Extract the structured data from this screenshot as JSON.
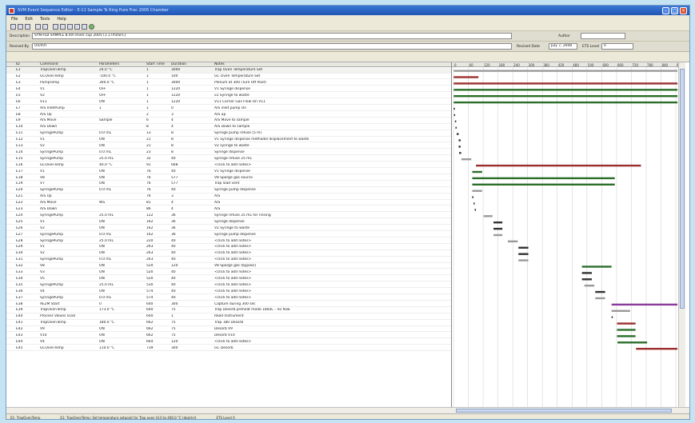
{
  "window": {
    "title": "SVM Event Sequence Editor - E-11 Sample Ts Ring Pure Frac 2005 Chamber"
  },
  "menu": [
    "File",
    "Edit",
    "Tools",
    "Help"
  ],
  "fields": {
    "description_label": "Description",
    "description_value": "SYN-FLB SAMPLE 8.4m River cup 2005 (1.17ml/SFC)",
    "revised_by_label": "Revised By",
    "revised_by_value": "UV/lnfT",
    "author_label": "Author",
    "author_value": "",
    "revised_date_label": "Revised Date",
    "revised_date_value": "July 7, 2008",
    "ets_level_label": "ETS Level",
    "ets_level_value": "0"
  },
  "columns": [
    "ID",
    "Command",
    "Parameters",
    "Start Time",
    "Duration",
    "Notes"
  ],
  "gantt_ticks": [
    "0",
    "60",
    "120",
    "180",
    "240",
    "300",
    "360",
    "420",
    "480",
    "540",
    "600",
    "660",
    "720",
    "780",
    "840",
    "900"
  ],
  "colors": {
    "green": "#2a6e2a",
    "red": "#9b2f2f",
    "purple": "#8a3a9a",
    "gray": "#9a9a9a",
    "black": "#333333"
  },
  "rows": [
    {
      "id": "E1",
      "cmd": "TrapOvenTemp",
      "par": "24.0 °C",
      "start": "1",
      "dur": "3000",
      "note": "Trap Oven Temperature Set",
      "bar": [
        1,
        3000
      ],
      "color": "gray"
    },
    {
      "id": "E2",
      "cmd": "GCOvenTemp",
      "par": "-100.0 °C",
      "start": "1",
      "dur": "100",
      "note": "GC Oven Temperature Set",
      "bar": [
        1,
        100
      ],
      "color": "red"
    },
    {
      "id": "E3",
      "cmd": "PumpTemp",
      "par": "300.0 °C",
      "start": "1",
      "dur": "3000",
      "note": "Plenum at 300 (Turn Off Poof)",
      "bar": [
        1,
        3000
      ],
      "color": "red"
    },
    {
      "id": "E4",
      "cmd": "V1",
      "par": "OFF",
      "start": "1",
      "dur": "1220",
      "note": "V1 Syringe dispense",
      "bar": [
        1,
        1220
      ],
      "color": "green"
    },
    {
      "id": "E5",
      "cmd": "V2",
      "par": "OFF",
      "start": "1",
      "dur": "1220",
      "note": "v2 Syringe to waste",
      "bar": [
        1,
        1220
      ],
      "color": "green"
    },
    {
      "id": "E6",
      "cmd": "V11",
      "par": "ON",
      "start": "1",
      "dur": "1220",
      "note": "V11 Carrier Gas Flow On V11",
      "bar": [
        1,
        1220
      ],
      "color": "green"
    },
    {
      "id": "E7",
      "cmd": "A/S InletPump",
      "par": "1",
      "start": "1",
      "dur": "0",
      "note": "A/S inlet pump On",
      "bar": [
        1,
        4
      ],
      "color": "black"
    },
    {
      "id": "E8",
      "cmd": "A/S Up",
      "par": "",
      "start": "2",
      "dur": "3",
      "note": "A/S up",
      "bar": [
        2,
        3
      ],
      "color": "black"
    },
    {
      "id": "E9",
      "cmd": "A/S Move",
      "par": "Sample",
      "start": "6",
      "dur": "4",
      "note": "A/S Move to sample",
      "bar": [
        6,
        4
      ],
      "color": "black"
    },
    {
      "id": "E10",
      "cmd": "A/S Down",
      "par": "",
      "start": "8",
      "dur": "4",
      "note": "A/S Down to sample",
      "bar": [
        8,
        4
      ],
      "color": "black"
    },
    {
      "id": "E11",
      "cmd": "SyringePump",
      "par": "0.0 mL",
      "start": "13",
      "dur": "8",
      "note": "Syringe pump refuse (5 m)",
      "bar": [
        13,
        8
      ],
      "color": "black"
    },
    {
      "id": "E12",
      "cmd": "V1",
      "par": "ON",
      "start": "21",
      "dur": "8",
      "note": "V1 Syringe dispense methodol displacement to waste",
      "bar": [
        21,
        8
      ],
      "color": "black"
    },
    {
      "id": "E13",
      "cmd": "V2",
      "par": "ON",
      "start": "21",
      "dur": "8",
      "note": "V2 syringe to waste",
      "bar": [
        21,
        8
      ],
      "color": "black"
    },
    {
      "id": "E14",
      "cmd": "SyringePump",
      "par": "0.0 mL",
      "start": "23",
      "dur": "8",
      "note": "Syringe dispense",
      "bar": [
        23,
        8
      ],
      "color": "black"
    },
    {
      "id": "E15",
      "cmd": "SyringePump",
      "par": "25.0 mL",
      "start": "32",
      "dur": "40",
      "note": "Syringe refuse 25 mL",
      "bar": [
        32,
        40
      ],
      "color": "gray"
    },
    {
      "id": "E16",
      "cmd": "GCOvenTemp",
      "par": "40.0 °C",
      "start": "91",
      "dur": "668",
      "note": "<click to add notes>",
      "bar": [
        91,
        668
      ],
      "color": "red"
    },
    {
      "id": "E17",
      "cmd": "V1",
      "par": "ON",
      "start": "76",
      "dur": "40",
      "note": "V1 Syringe dispense",
      "bar": [
        76,
        40
      ],
      "color": "green"
    },
    {
      "id": "E18",
      "cmd": "V8",
      "par": "ON",
      "start": "76",
      "dur": "577",
      "note": "V8 Sparge gas source",
      "bar": [
        76,
        577
      ],
      "color": "green"
    },
    {
      "id": "E19",
      "cmd": "V7",
      "par": "ON",
      "start": "76",
      "dur": "577",
      "note": "Trap load vent",
      "bar": [
        76,
        577
      ],
      "color": "green"
    },
    {
      "id": "E20",
      "cmd": "SyringePump",
      "par": "0.0 mL",
      "start": "76",
      "dur": "40",
      "note": "Syringe pump dispense",
      "bar": [
        76,
        40
      ],
      "color": "gray"
    },
    {
      "id": "E21",
      "cmd": "A/S Up",
      "par": "",
      "start": "76",
      "dur": "3",
      "note": "A/S",
      "bar": [
        76,
        3
      ],
      "color": "black"
    },
    {
      "id": "E22",
      "cmd": "A/S Move",
      "par": "WS",
      "start": "81",
      "dur": "4",
      "note": "A/S",
      "bar": [
        81,
        4
      ],
      "color": "black"
    },
    {
      "id": "E23",
      "cmd": "A/S Down",
      "par": "",
      "start": "86",
      "dur": "4",
      "note": "A/S",
      "bar": [
        86,
        4
      ],
      "color": "black"
    },
    {
      "id": "E24",
      "cmd": "SyringePump",
      "par": "25.0 mL",
      "start": "122",
      "dur": "36",
      "note": "Syringe refuse 25 mL for rinsing",
      "bar": [
        122,
        36
      ],
      "color": "gray"
    },
    {
      "id": "E25",
      "cmd": "V1",
      "par": "ON",
      "start": "162",
      "dur": "36",
      "note": "Syringe dispense",
      "bar": [
        162,
        36
      ],
      "color": "black"
    },
    {
      "id": "E26",
      "cmd": "V2",
      "par": "ON",
      "start": "162",
      "dur": "36",
      "note": "V2 Syringe to waste",
      "bar": [
        162,
        36
      ],
      "color": "black"
    },
    {
      "id": "E27",
      "cmd": "SyringePump",
      "par": "0.0 mL",
      "start": "162",
      "dur": "36",
      "note": "Syringe pump dispense",
      "bar": [
        162,
        36
      ],
      "color": "gray"
    },
    {
      "id": "E28",
      "cmd": "SyringePump",
      "par": "25.0 mL",
      "start": "220",
      "dur": "40",
      "note": "<click to add notes>",
      "bar": [
        220,
        40
      ],
      "color": "gray"
    },
    {
      "id": "E29",
      "cmd": "V1",
      "par": "ON",
      "start": "263",
      "dur": "40",
      "note": "<click to add notes>",
      "bar": [
        263,
        40
      ],
      "color": "black"
    },
    {
      "id": "E30",
      "cmd": "V2",
      "par": "ON",
      "start": "263",
      "dur": "40",
      "note": "<click to add notes>",
      "bar": [
        263,
        40
      ],
      "color": "black"
    },
    {
      "id": "E31",
      "cmd": "SyringePump",
      "par": "0.0 mL",
      "start": "263",
      "dur": "40",
      "note": "<click to add notes>",
      "bar": [
        263,
        40
      ],
      "color": "gray"
    },
    {
      "id": "E32",
      "cmd": "V8",
      "par": "ON",
      "start": "520",
      "dur": "120",
      "note": "V8 Sparge gas (bypass)",
      "bar": [
        520,
        120
      ],
      "color": "green"
    },
    {
      "id": "E33",
      "cmd": "V3",
      "par": "ON",
      "start": "520",
      "dur": "40",
      "note": "<click to add notes>",
      "bar": [
        520,
        40
      ],
      "color": "black"
    },
    {
      "id": "E34",
      "cmd": "V5",
      "par": "ON",
      "start": "520",
      "dur": "40",
      "note": "<click to add notes>",
      "bar": [
        520,
        40
      ],
      "color": "black"
    },
    {
      "id": "E35",
      "cmd": "SyringePump",
      "par": "25.0 mL",
      "start": "530",
      "dur": "40",
      "note": "<click to add notes>",
      "bar": [
        530,
        40
      ],
      "color": "gray"
    },
    {
      "id": "E36",
      "cmd": "V4",
      "par": "ON",
      "start": "574",
      "dur": "40",
      "note": "<click to add notes>",
      "bar": [
        574,
        40
      ],
      "color": "black"
    },
    {
      "id": "E37",
      "cmd": "SyringePump",
      "par": "0.0 mL",
      "start": "574",
      "dur": "40",
      "note": "<click to add notes>",
      "bar": [
        574,
        40
      ],
      "color": "gray"
    },
    {
      "id": "E38",
      "cmd": "AE2M Start",
      "par": "0",
      "start": "640",
      "dur": "300",
      "note": "Capture during 300 sec",
      "bar": [
        640,
        300
      ],
      "color": "purple"
    },
    {
      "id": "E39",
      "cmd": "TrapOvenTemp",
      "par": "173.0 °C",
      "start": "640",
      "dur": "75",
      "note": "Trap Desorb preheat mode 180oC - no flow",
      "bar": [
        640,
        75
      ],
      "color": "gray"
    },
    {
      "id": "E40",
      "cmd": "Process Values Scan",
      "par": "",
      "start": "640",
      "dur": "1",
      "note": "Read Instrument",
      "bar": [
        640,
        1
      ],
      "color": "black"
    },
    {
      "id": "E41",
      "cmd": "TrapOvenTemp",
      "par": "180.0 °C",
      "start": "662",
      "dur": "75",
      "note": "Trap 180 Desorb",
      "bar": [
        662,
        75
      ],
      "color": "red"
    },
    {
      "id": "E42",
      "cmd": "V9",
      "par": "ON",
      "start": "662",
      "dur": "75",
      "note": "Desorb V9",
      "bar": [
        662,
        75
      ],
      "color": "green"
    },
    {
      "id": "E43",
      "cmd": "V10",
      "par": "ON",
      "start": "662",
      "dur": "75",
      "note": "Desorb V10",
      "bar": [
        662,
        75
      ],
      "color": "green"
    },
    {
      "id": "E44",
      "cmd": "V4",
      "par": "ON",
      "start": "664",
      "dur": "120",
      "note": "<click to add notes>",
      "bar": [
        664,
        120
      ],
      "color": "green"
    },
    {
      "id": "E45",
      "cmd": "GCOvenTemp",
      "par": "110.0 °C",
      "start": "739",
      "dur": "300",
      "note": "GC Desorb",
      "bar": [
        739,
        300
      ],
      "color": "red"
    }
  ],
  "status": {
    "left": "E1: TrapOvenTemp",
    "middle": "E1: TrapOvenTemp: Set temperature setpoint for Trap oven (0.0 to 400.0 °C (deg)(s))",
    "right": "ETS Level 0"
  }
}
